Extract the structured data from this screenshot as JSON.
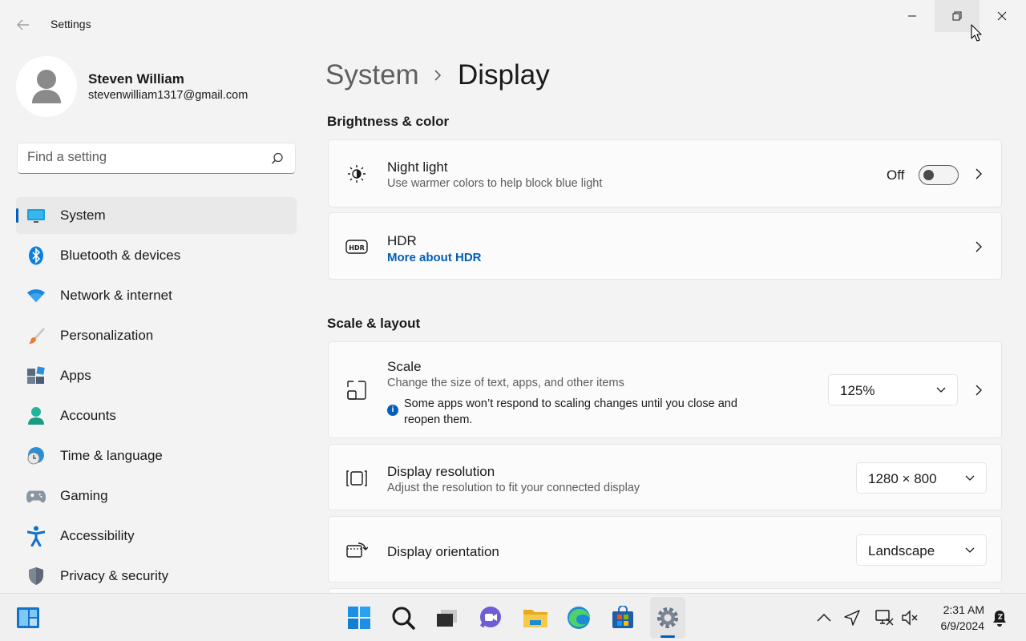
{
  "window": {
    "title": "Settings"
  },
  "profile": {
    "name": "Steven William",
    "email": "stevenwilliam1317@gmail.com"
  },
  "search": {
    "placeholder": "Find a setting",
    "value": ""
  },
  "sidebar": {
    "items": [
      {
        "label": "System",
        "icon": "system-icon",
        "active": true
      },
      {
        "label": "Bluetooth & devices",
        "icon": "bluetooth-icon"
      },
      {
        "label": "Network & internet",
        "icon": "wifi-icon"
      },
      {
        "label": "Personalization",
        "icon": "paintbrush-icon"
      },
      {
        "label": "Apps",
        "icon": "apps-icon"
      },
      {
        "label": "Accounts",
        "icon": "account-icon"
      },
      {
        "label": "Time & language",
        "icon": "globe-clock-icon"
      },
      {
        "label": "Gaming",
        "icon": "gamepad-icon"
      },
      {
        "label": "Accessibility",
        "icon": "accessibility-icon"
      },
      {
        "label": "Privacy & security",
        "icon": "shield-icon"
      }
    ]
  },
  "breadcrumb": {
    "parent": "System",
    "current": "Display"
  },
  "sections": {
    "brightness": {
      "title": "Brightness & color",
      "night_light": {
        "title": "Night light",
        "desc": "Use warmer colors to help block blue light",
        "toggle_label": "Off",
        "toggle_on": false
      },
      "hdr": {
        "title": "HDR",
        "link": "More about HDR"
      }
    },
    "scale_layout": {
      "title": "Scale & layout",
      "scale": {
        "title": "Scale",
        "desc": "Change the size of text, apps, and other items",
        "info": "Some apps won’t respond to scaling changes until you close and reopen them.",
        "info_glyph": "i",
        "value": "125%"
      },
      "resolution": {
        "title": "Display resolution",
        "desc": "Adjust the resolution to fit your connected display",
        "value": "1280 × 800"
      },
      "orientation": {
        "title": "Display orientation",
        "value": "Landscape"
      }
    }
  },
  "taskbar": {
    "apps": [
      "windows-start-icon",
      "search-icon",
      "task-view-icon",
      "teams-chat-icon",
      "file-explorer-icon",
      "edge-icon",
      "store-icon",
      "settings-icon"
    ],
    "tray": [
      "chevron-up-icon",
      "location-icon",
      "network-icon",
      "volume-muted-icon",
      "notification-icon"
    ],
    "time": "2:31 AM",
    "date": "6/9/2024"
  },
  "colors": {
    "accent": "#005fb8",
    "background": "#f3f3f3",
    "card": "#fbfbfb"
  }
}
